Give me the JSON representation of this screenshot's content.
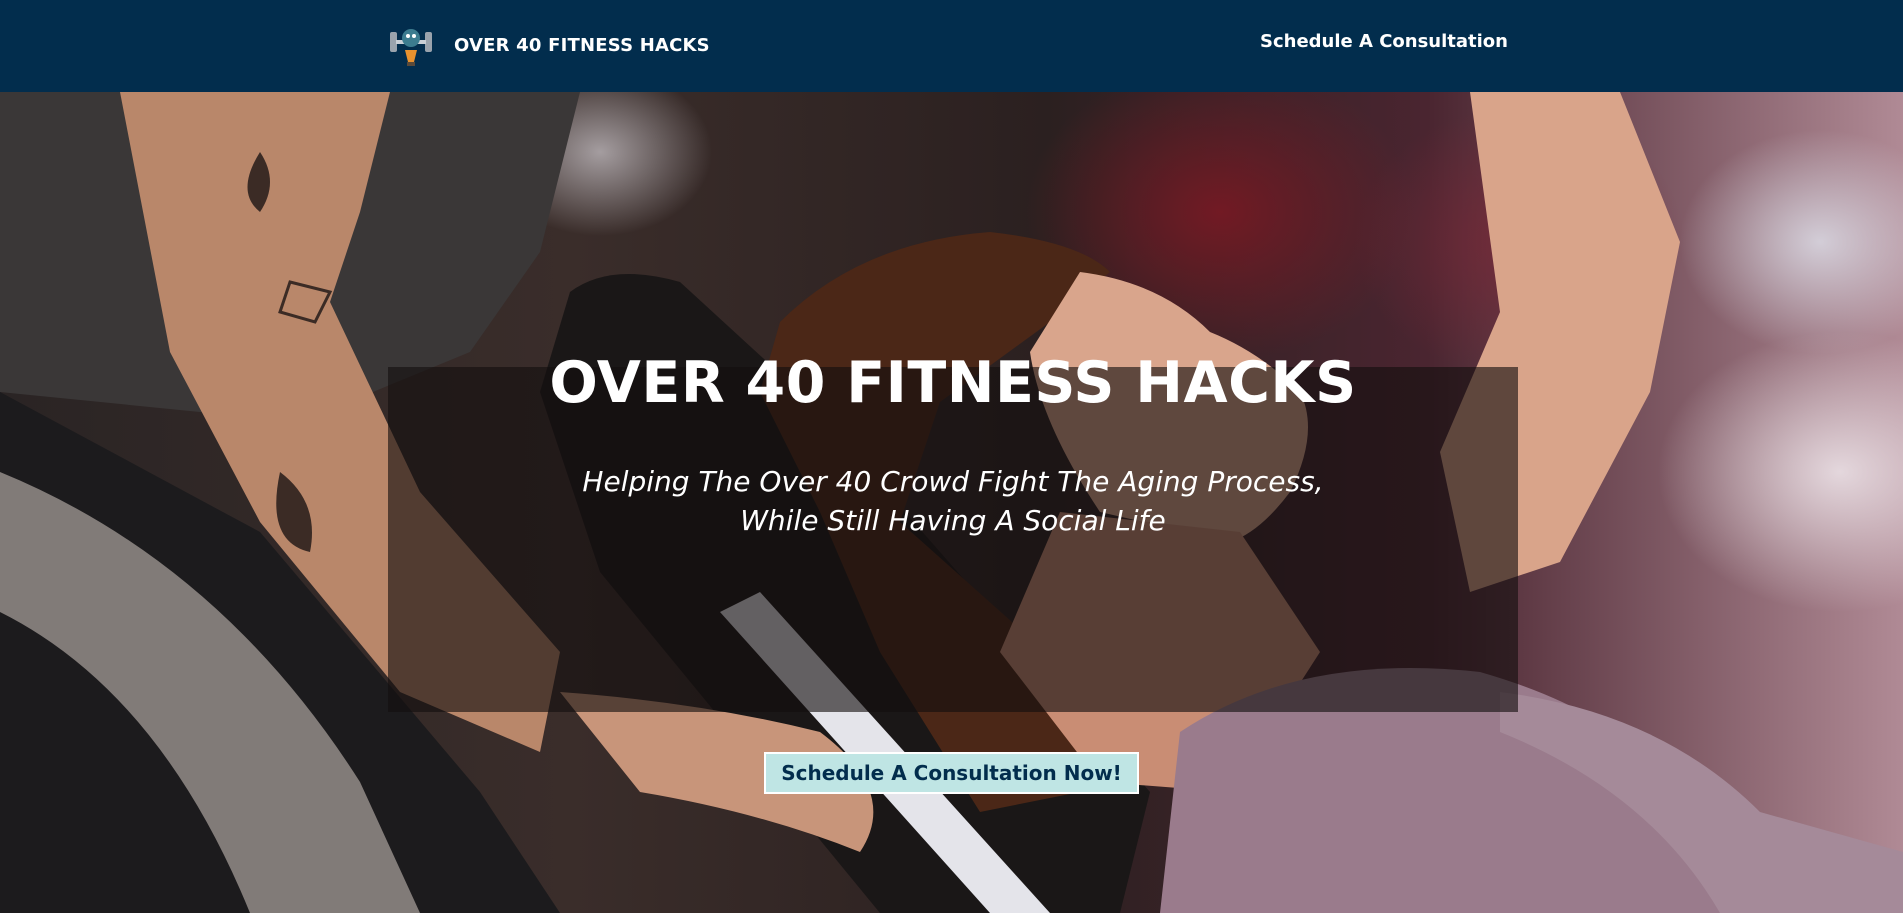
{
  "header": {
    "logo_icon": "dumbbell-mascot-icon",
    "brand_name": "OVER 40 FITNESS HACKS",
    "nav_link": "Schedule A Consultation",
    "background_color": "#022d4d"
  },
  "hero": {
    "image_icon": "gym-trainer-photo",
    "title": "OVER 40 FITNESS HACKS",
    "subtitle_line1": "Helping The Over 40 Crowd Fight The Aging Process,",
    "subtitle_line2": "While Still Having A Social Life",
    "cta_label": "Schedule A Consultation Now!",
    "cta_color": "#bfe5e4"
  }
}
